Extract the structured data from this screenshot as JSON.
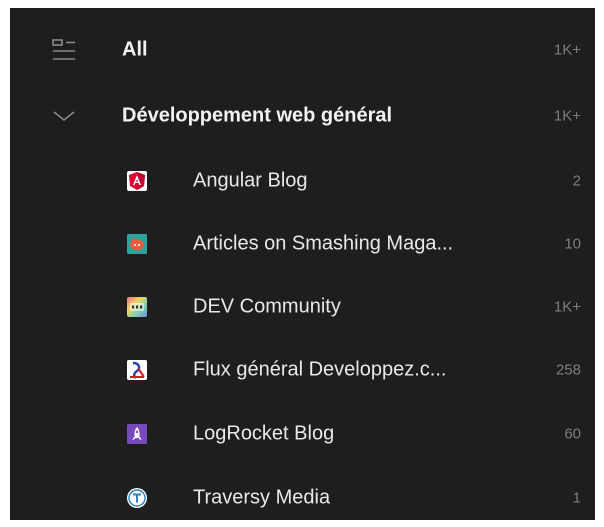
{
  "header_row": {
    "label": "All",
    "count": "1K+",
    "icon": "list-filter-icon"
  },
  "folder": {
    "label": "Développement web général",
    "count": "1K+",
    "icon": "chevron-down-icon"
  },
  "feeds": [
    {
      "label": "Angular Blog",
      "count": "2",
      "icon": "angular-logo-icon",
      "color": "#dd0031"
    },
    {
      "label": "Articles on Smashing Maga...",
      "count": "10",
      "icon": "smashing-cat-icon",
      "color": "#e85c41"
    },
    {
      "label": "DEV Community",
      "count": "1K+",
      "icon": "dev-logo-icon",
      "color": "#a3a3a3"
    },
    {
      "label": "Flux général Developpez.c...",
      "count": "258",
      "icon": "developpez-logo-icon",
      "color": "#cc2222"
    },
    {
      "label": "LogRocket Blog",
      "count": "60",
      "icon": "rocket-icon",
      "color": "#764abc"
    },
    {
      "label": "Traversy Media",
      "count": "1",
      "icon": "traversy-logo-icon",
      "color": "#2f7fb8"
    }
  ],
  "colors": {
    "background": "#1e1e1e",
    "text": "#e8e8e8",
    "count": "#7d7d7d"
  }
}
